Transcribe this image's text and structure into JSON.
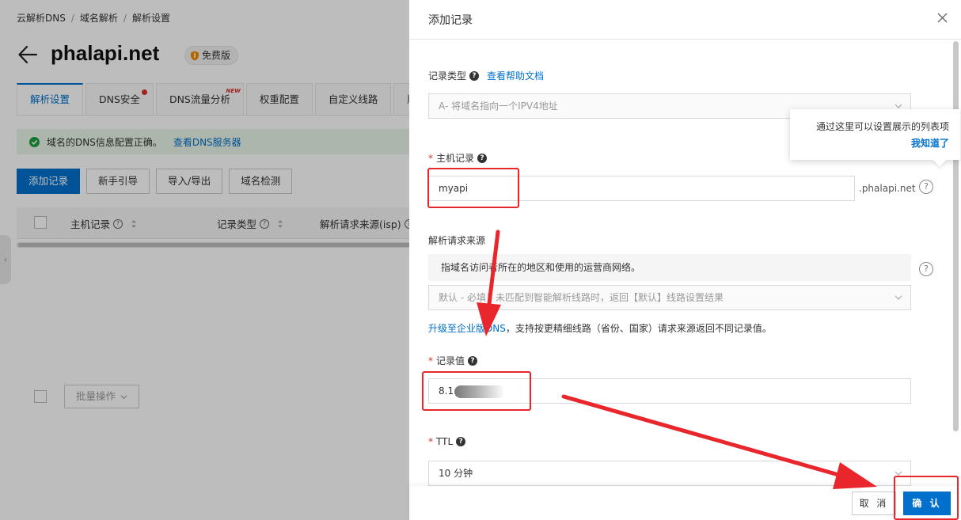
{
  "breadcrumb": [
    "云解析DNS",
    "域名解析",
    "解析设置"
  ],
  "page": {
    "title": "phalapi.net",
    "badge": "免费版"
  },
  "tabs": [
    {
      "label": "解析设置",
      "active": true
    },
    {
      "label": "DNS安全",
      "dot": true
    },
    {
      "label": "DNS流量分析",
      "new": "NEW"
    },
    {
      "label": "权重配置"
    },
    {
      "label": "自定义线路"
    },
    {
      "label": "版"
    }
  ],
  "notice": {
    "text": "域名的DNS信息配置正确。",
    "link": "查看DNS服务器"
  },
  "actions": [
    "添加记录",
    "新手引导",
    "导入/导出",
    "域名检测"
  ],
  "table": {
    "columns": [
      "主机记录",
      "记录类型",
      "解析请求来源(isp)"
    ]
  },
  "bottom": {
    "batch_label": "批量操作"
  },
  "drawer": {
    "title": "添加记录",
    "record_type": {
      "label": "记录类型",
      "help_link": "查看帮助文档",
      "value": "A- 将域名指向一个IPV4地址"
    },
    "host": {
      "label": "主机记录",
      "value": "myapi",
      "suffix": ".phalapi.net"
    },
    "source": {
      "label": "解析请求来源",
      "desc": "指域名访问者所在的地区和使用的运营商网络。",
      "value": "默认 - 必填！未匹配到智能解析线路时，返回【默认】线路设置结果",
      "upgrade_link": "升级至企业版DNS",
      "upgrade_text": "，支持按更精细线路（省份、国家）请求来源返回不同记录值。"
    },
    "value_field": {
      "label": "记录值",
      "value": "8.1"
    },
    "ttl": {
      "label": "TTL",
      "value": "10 分钟"
    },
    "tooltip": {
      "text": "通过这里可以设置展示的列表项",
      "link": "我知道了"
    },
    "cancel": "取 消",
    "confirm": "确 认"
  },
  "colors": {
    "primary": "#0070cc",
    "annotation": "#e8262b",
    "required": "#d93026"
  }
}
